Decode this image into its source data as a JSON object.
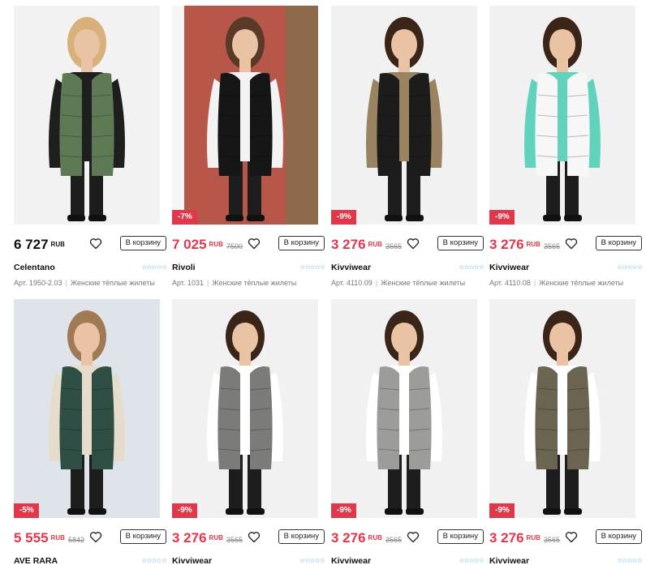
{
  "currency": "RUB",
  "cart_label": "В корзину",
  "products": [
    {
      "price": "6 727",
      "old_price": "",
      "discount": "",
      "brand": "Celentano",
      "article": "Арт. 1950-2.03",
      "category": "Женские тёплые жилеты",
      "image": "woman-green-long-vest",
      "colors": {
        "bg": "#f2f2f2",
        "garment": "#5e7a55",
        "inner": "#1e1e1e",
        "hair": "#d8b07a"
      }
    },
    {
      "price": "7 025",
      "old_price": "7500",
      "discount": "-7%",
      "brand": "Rivoli",
      "article": "Арт. 1031",
      "category": "Женские тёплые жилеты",
      "image": "woman-black-puffer-vest-studio",
      "colors": {
        "bg": "#b6574a",
        "garment": "#161616",
        "inner": "#f3f3f3",
        "hair": "#5a3a26"
      }
    },
    {
      "price": "3 276",
      "old_price": "3565",
      "discount": "-9%",
      "brand": "Kivviwear",
      "article": "Арт. 4110.09",
      "category": "Женские тёплые жилеты",
      "image": "woman-black-puffer-vest",
      "colors": {
        "bg": "#f1f1f1",
        "garment": "#1c1c1c",
        "inner": "#9a8360",
        "hair": "#3b2519"
      }
    },
    {
      "price": "3 276",
      "old_price": "3565",
      "discount": "-9%",
      "brand": "Kivviwear",
      "article": "Арт. 4110.08",
      "category": "Женские тёплые жилеты",
      "image": "woman-white-puffer-vest",
      "colors": {
        "bg": "#f1f1f1",
        "garment": "#f7f7f7",
        "inner": "#61d3bd",
        "hair": "#3b2519"
      }
    },
    {
      "price": "5 555",
      "old_price": "5842",
      "discount": "-5%",
      "brand": "AVE RARA",
      "article": "",
      "category": "",
      "image": "woman-green-metallic-vest",
      "colors": {
        "bg": "#dfe4ea",
        "garment": "#2f4f45",
        "inner": "#e6dccb",
        "hair": "#a07a55"
      }
    },
    {
      "price": "3 276",
      "old_price": "3565",
      "discount": "-9%",
      "brand": "Kivviwear",
      "article": "",
      "category": "",
      "image": "woman-grey-quilted-vest",
      "colors": {
        "bg": "#f1f1f1",
        "garment": "#7b7b78",
        "inner": "#ffffff",
        "hair": "#3b2519"
      }
    },
    {
      "price": "3 276",
      "old_price": "3565",
      "discount": "-9%",
      "brand": "Kivviwear",
      "article": "",
      "category": "",
      "image": "woman-light-grey-vest",
      "colors": {
        "bg": "#f1f1f1",
        "garment": "#9c9c98",
        "inner": "#ffffff",
        "hair": "#3b2519"
      }
    },
    {
      "price": "3 276",
      "old_price": "3565",
      "discount": "-9%",
      "brand": "Kivviwear",
      "article": "",
      "category": "",
      "image": "woman-olive-quilted-vest",
      "colors": {
        "bg": "#f1f1f1",
        "garment": "#6a6450",
        "inner": "#ffffff",
        "hair": "#3b2519"
      }
    }
  ]
}
